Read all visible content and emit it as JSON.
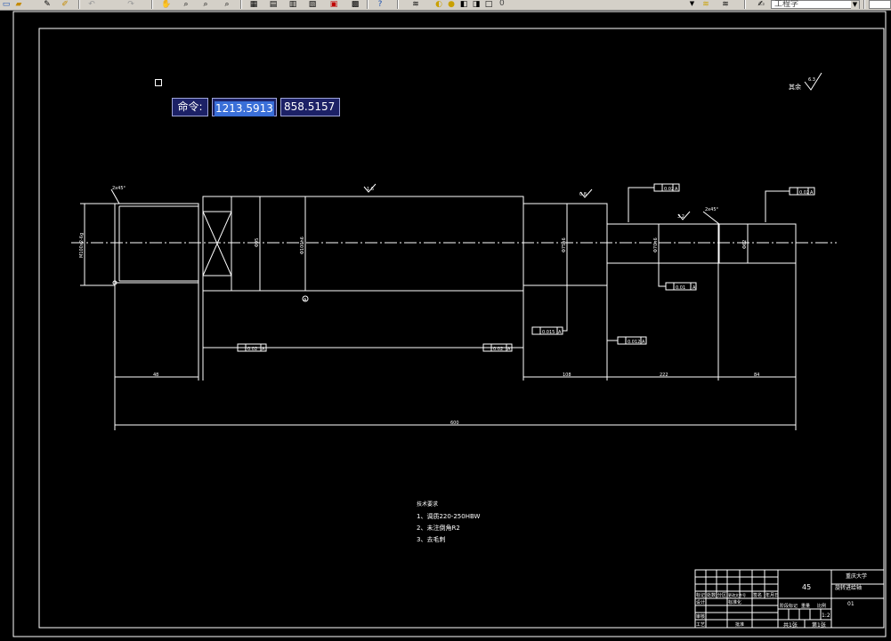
{
  "toolbar": {
    "icons": [
      "new-icon",
      "open-icon",
      "pencil-icon",
      "edit-icon",
      "undo-icon",
      "redo-icon",
      "pan-icon",
      "zoom-realtime-icon",
      "zoom-window-icon",
      "zoom-previous-icon",
      "properties-icon",
      "design-center-icon",
      "tool-palette-icon",
      "sheet-set-icon",
      "markup-icon",
      "calculator-icon",
      "help-icon",
      "layer-icon",
      "bulb-icon",
      "sun-icon",
      "freeze-icon",
      "lock-icon",
      "color-icon",
      "layer-states-icon",
      "layer-previous-icon",
      "text-style-icon"
    ],
    "layer_value": "0",
    "text_style_value": "工程字"
  },
  "command": {
    "label": "命令:",
    "x_value": "1213.5913",
    "y_value": "858.5157"
  },
  "drawing": {
    "notes_title": "技术要求",
    "notes": [
      "1、调质220-250HBW",
      "2、未注倒角R2",
      "3、去毛刺"
    ],
    "roughness_symbol": "其余",
    "roughness_value": "6.3",
    "dimensions": {
      "left_len": "48",
      "mid_len": "108",
      "right_len": "222",
      "end_len": "84",
      "total": "600",
      "thread": "M100x2-6g",
      "dia1": "Φ95",
      "dia2": "Φ100h6",
      "dia3": "Φ75h6",
      "dia4": "Φ70h6",
      "dia5": "Φ62",
      "ra1": "0.8",
      "ra2": "1.6",
      "ra3": "3.2",
      "chamfer1": "2x45°",
      "chamfer2": "2x45°"
    },
    "tolerances": {
      "t1": "0.02",
      "t2": "0.02",
      "t3": "0.01",
      "t4": "0.015",
      "t5": "0.012",
      "t6": "0.02",
      "ref": "A",
      "datum": "A"
    },
    "title_block": {
      "material": "45",
      "school": "重庆大学",
      "part_name": "旋转进给轴",
      "drawing_no": "01",
      "scale": "1:2",
      "sheet": "共1张",
      "sheet_of": "第1张",
      "design": "设计",
      "check": "审核",
      "approve": "批准",
      "process": "工艺",
      "mark": "标记",
      "count": "处数",
      "zone": "分区",
      "change_no": "更改文件号",
      "signature": "签名",
      "date": "年月日",
      "standard": "标准化",
      "weight": "重量",
      "ratio": "比例",
      "stage": "阶段标记"
    }
  }
}
